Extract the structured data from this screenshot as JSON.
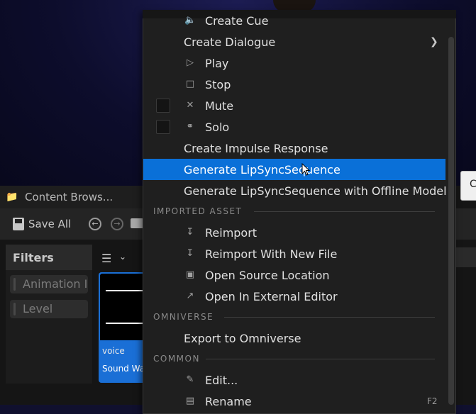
{
  "content_browser": {
    "tab_title": "Content Brows...",
    "save_all_label": "Save All",
    "filters_label": "Filters",
    "filter_chips": [
      "Animation I",
      "Level"
    ],
    "asset": {
      "type_label": "voice",
      "name": "Sound Wav"
    },
    "tooltip_fragment": "C"
  },
  "context_menu": {
    "items": [
      {
        "label": "Create Cue",
        "icon": "speaker-icon"
      },
      {
        "label": "Create Dialogue",
        "submenu": true
      },
      {
        "label": "Play",
        "icon": "play-icon"
      },
      {
        "label": "Stop",
        "icon": "stop-icon"
      },
      {
        "label": "Mute",
        "icon": "mute-icon",
        "checked": false
      },
      {
        "label": "Solo",
        "icon": "headphones-icon",
        "checked": false
      },
      {
        "label": "Create Impulse Response"
      },
      {
        "label": "Generate LipSyncSequence",
        "highlighted": true
      },
      {
        "label": "Generate LipSyncSequence with Offline Model"
      }
    ],
    "sections": {
      "imported_asset": {
        "header": "IMPORTED ASSET",
        "items": [
          {
            "label": "Reimport",
            "icon": "reimport-icon"
          },
          {
            "label": "Reimport With New File",
            "icon": "reimport-file-icon"
          },
          {
            "label": "Open Source Location",
            "icon": "folder-open-icon"
          },
          {
            "label": "Open In External Editor",
            "icon": "external-editor-icon"
          }
        ]
      },
      "omniverse": {
        "header": "OMNIVERSE",
        "items": [
          {
            "label": "Export to Omniverse"
          }
        ]
      },
      "common": {
        "header": "COMMON",
        "items": [
          {
            "label": "Edit...",
            "icon": "pencil-icon"
          },
          {
            "label": "Rename",
            "icon": "rename-icon",
            "shortcut": "F2"
          }
        ]
      }
    }
  },
  "colors": {
    "highlight": "#0a70d8",
    "menu_bg": "#1f1f1f",
    "asset_tile": "#1a6fd6"
  }
}
